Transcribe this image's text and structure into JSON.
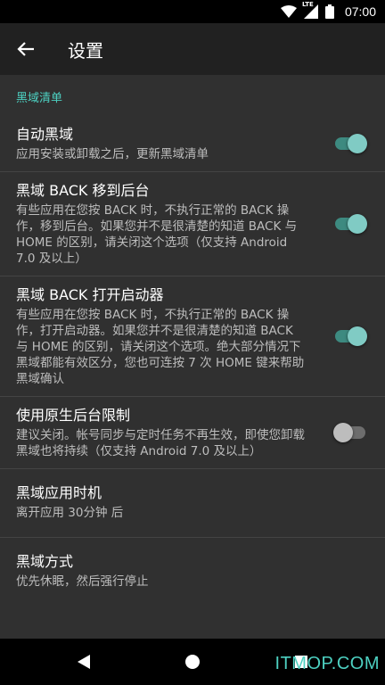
{
  "status_bar": {
    "time": "07:00",
    "network": "LTE",
    "icons": [
      "wifi-icon",
      "cell-signal-icon",
      "battery-icon"
    ]
  },
  "app_bar": {
    "title": "设置",
    "back_icon": "arrow-back-icon"
  },
  "category": "黑域清单",
  "prefs": [
    {
      "title": "自动黑域",
      "summary": "应用安装或卸载之后，更新黑域清单",
      "switch": "on"
    },
    {
      "title": "黑域 BACK 移到后台",
      "summary": "有些应用在您按 BACK 时，不执行正常的 BACK 操作，移到后台。如果您并不是很清楚的知道 BACK 与 HOME 的区别，请关闭这个选项（仅支持 Android 7.0 及以上）",
      "switch": "on"
    },
    {
      "title": "黑域 BACK 打开启动器",
      "summary": "有些应用在您按 BACK 时，不执行正常的 BACK 操作，打开启动器。如果您并不是很清楚的知道 BACK 与 HOME 的区别，请关闭这个选项。绝大部分情况下黑域都能有效区分，您也可连按 7 次 HOME 键来帮助黑域确认",
      "switch": "on"
    },
    {
      "title": "使用原生后台限制",
      "summary": "建议关闭。帐号同步与定时任务不再生效，即使您卸载黑域也将持续（仅支持 Android 7.0 及以上）",
      "switch": "off"
    },
    {
      "title": "黑域应用时机",
      "summary": "离开应用 30分钟 后"
    },
    {
      "title": "黑域方式",
      "summary": "优先休眠，然后强行停止"
    }
  ],
  "nav_bar": {
    "icons": [
      "back-triangle-icon",
      "home-circle-icon",
      "recents-square-icon"
    ]
  },
  "watermark": "ITMOP.COM",
  "colors": {
    "accent": "#4dd0c1",
    "switch_on_thumb": "#80cbc4",
    "background": "#303030",
    "app_bar": "#212121"
  }
}
